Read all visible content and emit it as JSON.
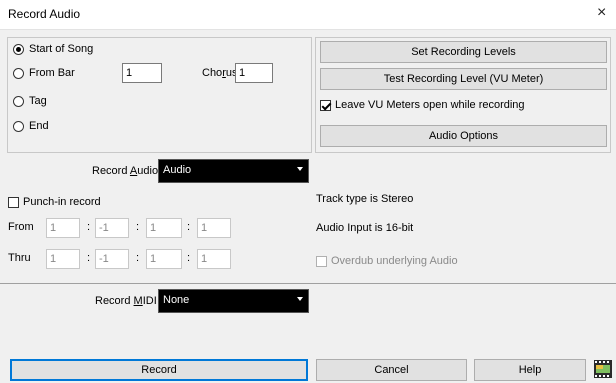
{
  "window": {
    "title": "Record Audio",
    "close_glyph": "×"
  },
  "start": {
    "options": [
      "Start of Song",
      "From Bar",
      "Tag",
      "End"
    ],
    "selected_index": 0,
    "from_bar_value": "1",
    "chorus_label_pre": "Cho",
    "chorus_label_accel": "r",
    "chorus_label_post": "us",
    "chorus_value": "1"
  },
  "right_buttons": {
    "set_levels": "Set Recording Levels",
    "test_level": "Test Recording Level (VU Meter)",
    "leave_vu_label": "Leave VU Meters open while recording",
    "leave_vu_checked": true,
    "audio_options": "Audio Options"
  },
  "record_audio": {
    "label_pre": "Record ",
    "label_accel": "A",
    "label_post": "udio to:",
    "value": "Audio"
  },
  "punch": {
    "label": "Punch-in record",
    "checked": false,
    "from_label": "From",
    "thru_label": "Thru",
    "separator": ":",
    "from_values": [
      "1",
      "-1",
      "1",
      "1"
    ],
    "thru_values": [
      "1",
      "-1",
      "1",
      "1"
    ]
  },
  "info": {
    "track_type": "Track type is Stereo",
    "audio_input": "Audio Input is 16-bit",
    "overdub_label": "Overdub underlying Audio",
    "overdub_checked": false
  },
  "record_midi": {
    "label_pre": "Record ",
    "label_accel": "M",
    "label_post": "IDI to:",
    "value": "None"
  },
  "bottom_buttons": {
    "record": "Record",
    "cancel": "Cancel",
    "help": "Help"
  },
  "colors": {
    "accent": "#0078d7",
    "dropdown_bg": "#000000"
  }
}
